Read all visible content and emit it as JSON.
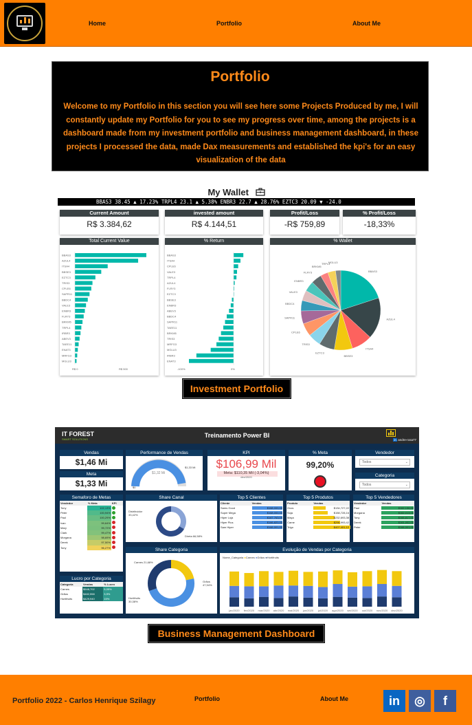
{
  "nav": {
    "logo_icon": "monitor-chart-logo",
    "links": [
      "Home",
      "Portfolio",
      "About Me"
    ]
  },
  "hero": {
    "title": "Portfolio",
    "text": "Welcome to my Portfolio in this section you will see here some Projects Produced by me, I will constantly update my Portfolio for you to see my progress over time, among the projects is a dashboard made from my investment portfolio and business management dashboard, in these projects I processed the data, made Dax measurements and established the kpi's for an easy visualization of the data"
  },
  "wallet": {
    "title": "My Wallet",
    "icon": "briefcase-icon",
    "ticker": "BBAS3 38.45 ▲ 17.23%   TRPL4 23.1 ▲ 5.38%   ENBR3 22.7 ▲ 28.76%   EZTC3 20.09 ▼ -24.0",
    "kpis": [
      {
        "label": "Current Amount",
        "value": "R$ 3.384,62"
      },
      {
        "label": "invested amount",
        "value": "R$ 4.144,51"
      },
      {
        "label": "Profit/Loss",
        "value": "-R$ 759,89"
      },
      {
        "label": "% Profit/Loss",
        "value": "-18,33%"
      }
    ],
    "panels": [
      "Total Current Value",
      "% Return",
      "% Wallet"
    ],
    "bar_tickers": [
      "BBAS3",
      "AZUL4",
      "ITSA4",
      "BBSE3",
      "EZTC3",
      "TRIS3",
      "CPLE6",
      "SAPR11",
      "BBDC4",
      "VALE3",
      "ENBR3",
      "FLRY3",
      "BRKM5",
      "TRPL4",
      "IRBR3",
      "ABEV3",
      "TAEE11",
      "ENAT3",
      "MRFG3",
      "MGLU3"
    ],
    "current_values": [
      610,
      540,
      280,
      225,
      175,
      150,
      140,
      125,
      110,
      95,
      85,
      75,
      65,
      55,
      48,
      40,
      32,
      25,
      20,
      14
    ],
    "current_axis": [
      "R$ 0",
      "R$ 500"
    ],
    "return_tickers": [
      "BBAS3",
      "ITSA4",
      "CPLE6",
      "VALE3",
      "TRPL4",
      "AZUL4",
      "FLRY3",
      "EZTC3",
      "BBSE3",
      "ENBR3",
      "ABEV3",
      "BBDC4",
      "SAPR11",
      "TAEE11",
      "BRKM5",
      "TRIS3",
      "MRFG3",
      "MGLU3",
      "IRBR3",
      "ENAT3"
    ],
    "returns": [
      17,
      12,
      8,
      6,
      5,
      2,
      1,
      0,
      -3,
      -5,
      -8,
      -12,
      -15,
      -18,
      -22,
      -26,
      -30,
      -40,
      -65,
      -78
    ],
    "return_axis": [
      "-100%",
      "0%"
    ],
    "pie_labels": [
      "BBAS3",
      "AZUL4",
      "ITSA4",
      "BBSE3",
      "EZTC3",
      "TRIS3",
      "CPLE6",
      "SAPR11",
      "BBDC4",
      "VALE3",
      "ENBR3",
      "FLRY3",
      "BRKM5",
      "TRPL4",
      "MGLU3"
    ],
    "pie_values": [
      19,
      16,
      8,
      7,
      6,
      5,
      5,
      5,
      4,
      4,
      4,
      4,
      3,
      3,
      2
    ],
    "pie_colors": [
      "#01b8aa",
      "#374649",
      "#fd625e",
      "#f2c80f",
      "#5f6b6d",
      "#8ad4eb",
      "#fe9666",
      "#a66999",
      "#3599b8",
      "#dfbfbf",
      "#4ac5bb",
      "#5f6b6d",
      "#fb8281",
      "#f4d25a",
      "#7f898a"
    ],
    "caption": "Investment Portfolio"
  },
  "dashboard": {
    "brand": "IT FOREST",
    "brand_sub": "SMART SOLUTIONS",
    "title": "Treinamento Power BI",
    "handle": "andre-rosa77",
    "cards": {
      "vendas_label": "Vendas",
      "vendas_value": "$1,46 Mi",
      "meta_label": "Meta",
      "meta_value": "$1,33 Mi",
      "perf_label": "Performance de Vendas",
      "perf_center": "$1,32 Mi",
      "perf_max": "$1,33 Mi",
      "perf_zero": "$0",
      "kpi_label": "KPI",
      "kpi_value": "$106,99 Mil",
      "kpi_sub": "Meta: $110,35 Mil (-3,04%)",
      "kpi_date": "dez/2020",
      "pmeta_label": "% Meta",
      "pmeta_value": "99,20%",
      "vendedor_label": "Vendedor",
      "categoria_label": "Categoria",
      "todos": "Todos"
    },
    "semaforo": {
      "title": "Semaforo de Metas",
      "headers": [
        "Vendedor",
        "% Meta",
        "KPI"
      ],
      "rows": [
        [
          "Tony",
          "102,13%"
        ],
        [
          "Peter",
          "100,94%"
        ],
        [
          "Paul",
          "100,29%"
        ],
        [
          "Ivan",
          "99,64%"
        ],
        [
          "Mary",
          "99,72%"
        ],
        [
          "Clark",
          "99,47%"
        ],
        [
          "Morgana",
          "98,69%"
        ],
        [
          "Derek",
          "97,50%"
        ],
        [
          "Tony",
          "96,27%"
        ]
      ],
      "values": [
        102.13,
        100.94,
        100.29,
        99.64,
        99.72,
        99.47,
        98.69,
        97.5,
        96.27
      ],
      "kpi_colors": [
        "#2ca02c",
        "#2ca02c",
        "#2ca02c",
        "#d62728",
        "#d62728",
        "#d62728",
        "#d62728",
        "#d62728",
        "#d62728"
      ]
    },
    "lucro": {
      "title": "Lucro por Categoria",
      "headers": [
        "Categoria",
        "Vendas",
        "% Lucro"
      ],
      "rows": [
        [
          "Carnes",
          "$548,702",
          "5,05%"
        ],
        [
          "Grãos",
          "$482,558",
          "3,9%"
        ],
        [
          "Hortifruits",
          "$429,940",
          "15%"
        ]
      ]
    },
    "share_canal": {
      "title": "Share Canal",
      "a_label": "Distribuidor 33,42%",
      "b_label": "Direta 66,58%",
      "values": [
        33.42,
        66.58
      ]
    },
    "share_categoria": {
      "title": "Share Categoria",
      "labels": [
        "Carnes 21,68%",
        "Grãos 47,94%",
        "Hortifruits 30,38%"
      ],
      "values": [
        21.68,
        47.94,
        30.38
      ]
    },
    "top_clientes": {
      "title": "Top 5 Clientes",
      "headers": [
        "Cliente",
        "Vendas"
      ],
      "rows": [
        [
          "Sams Good",
          "$168,000,00"
        ],
        [
          "Super Mega",
          "$168,000,00"
        ],
        [
          "Hiper Loja",
          "$167,763,09"
        ],
        [
          "Hiper Plus",
          "$166,820,00"
        ],
        [
          "Sam Hiper",
          "$166,001,00"
        ]
      ]
    },
    "top_produtos": {
      "title": "Top 5 Produtos",
      "headers": [
        "Produto",
        "Vendas"
      ],
      "rows": [
        [
          "Ovos",
          "$134,727,22"
        ],
        [
          "Soja",
          "$158,728,16"
        ],
        [
          "Maça",
          "$232,693,38"
        ],
        [
          "Carne",
          "$296,993,42"
        ],
        [
          "Trigo",
          "$407,401,12"
        ]
      ],
      "values": [
        134,
        158,
        232,
        296,
        407
      ]
    },
    "top_vendedores": {
      "title": "Top 5 Vendedores",
      "headers": [
        "Vendedor",
        "Vendas"
      ],
      "rows": [
        [
          "Paul",
          "$162,136,00"
        ],
        [
          "Morgana",
          "$162,013,00"
        ],
        [
          "Tony",
          "$166,817,00"
        ],
        [
          "Derek",
          "$161,002,00"
        ],
        [
          "Peter",
          "$166,001,00"
        ]
      ]
    },
    "evolucao": {
      "title": "Evolução de Vendas por Categoria",
      "legend_title": "Nome_Categoria",
      "series_names": [
        "Carnes",
        "Grãos",
        "Hortifruits"
      ],
      "months": [
        "jan/2020",
        "fev/2020",
        "mar/2020",
        "abr/2020",
        "mai/2020",
        "jun/2020",
        "jul/2020",
        "ago/2020",
        "set/2020",
        "out/2020",
        "nov/2020",
        "dez/2020"
      ],
      "carnes": [
        38,
        35,
        40,
        36,
        39,
        37,
        41,
        36,
        38,
        40,
        37,
        39
      ],
      "graos": [
        30,
        32,
        28,
        33,
        29,
        31,
        30,
        34,
        29,
        31,
        33,
        30
      ],
      "horti": [
        25,
        22,
        26,
        23,
        27,
        24,
        22,
        26,
        24,
        23,
        27,
        25
      ],
      "colors": [
        "#f2c80f",
        "#5a7fd6",
        "#1f3b6e"
      ]
    },
    "caption": "Business Management Dashboard"
  },
  "footer": {
    "credit": "Portfolio 2022 - Carlos Henrique Szilagy",
    "links": [
      "Portfolio",
      "About Me"
    ],
    "social": [
      {
        "name": "linkedin-icon",
        "glyph": "in",
        "color": "#0a66c2"
      },
      {
        "name": "instagram-icon",
        "glyph": "◎",
        "color": "#3f5f9e"
      },
      {
        "name": "facebook-icon",
        "glyph": "f",
        "color": "#3b5998"
      }
    ]
  }
}
